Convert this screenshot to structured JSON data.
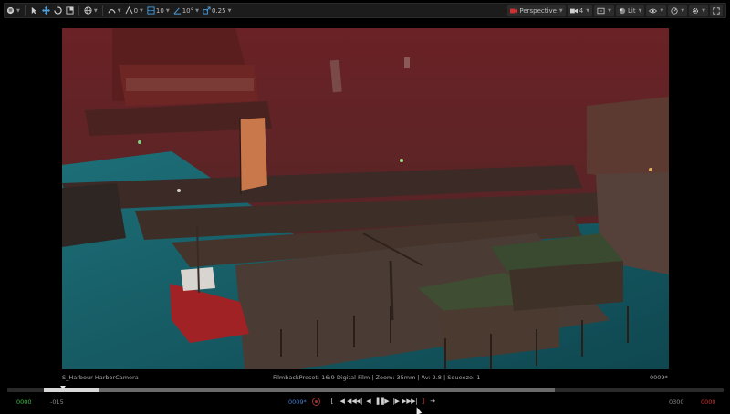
{
  "toolbar": {
    "snap_angle_value": "0",
    "grid_size_value": "10",
    "rotation_snap_value": "10°",
    "scale_snap_value": "0.25",
    "view_mode_label": "Perspective",
    "camera_speed_value": "4",
    "lighting_mode_label": "Lit"
  },
  "viewport_info": {
    "camera_name": "S_Harbour HarborCamera",
    "filmback_info": "FilmbackPreset: 16:9 Digital Film | Zoom: 35mm | Av: 2.8 | Squeeze: 1",
    "frame_readout": "0009*"
  },
  "timeline": {
    "start_frame": "0000",
    "play_start": "-015",
    "current_frame": "0009*",
    "play_end": "0300",
    "end_frame": "0000",
    "transport": [
      "[",
      "|◀",
      "◀◀",
      "◀|",
      "◀",
      "▐▐",
      "▶",
      "|▶",
      "▶▶",
      "▶|",
      "]",
      "→"
    ]
  },
  "colors": {
    "accent_green": "#3fbf4a",
    "accent_red": "#d03030",
    "accent_blue": "#4a7fcf",
    "toolbar_bg": "#1c1c1c"
  }
}
